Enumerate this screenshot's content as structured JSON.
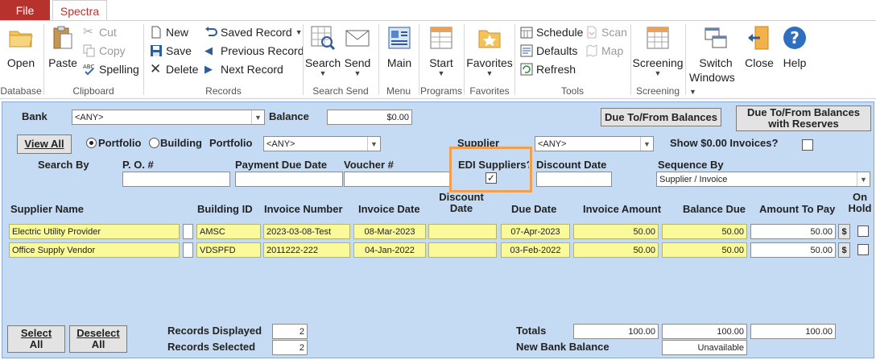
{
  "tabs": {
    "file": "File",
    "spectra": "Spectra"
  },
  "ribbon": {
    "database": {
      "label": "Database",
      "open": "Open"
    },
    "clipboard": {
      "label": "Clipboard",
      "paste": "Paste",
      "cut": "Cut",
      "copy": "Copy",
      "spelling": "Spelling"
    },
    "records": {
      "label": "Records",
      "new": "New",
      "save": "Save",
      "delete": "Delete",
      "saved_record": "Saved Record",
      "previous_record": "Previous Record",
      "next_record": "Next Record"
    },
    "search_send": {
      "label": "Search Send",
      "search": "Search",
      "send": "Send"
    },
    "menu": {
      "label": "Menu",
      "main": "Main"
    },
    "programs": {
      "label": "Programs",
      "start": "Start"
    },
    "favorites": {
      "label": "Favorites",
      "favorites": "Favorites"
    },
    "tools": {
      "label": "Tools",
      "schedule": "Schedule",
      "defaults": "Defaults",
      "refresh": "Refresh",
      "scan": "Scan",
      "map": "Map"
    },
    "screening": {
      "label": "Screening",
      "screening": "Screening"
    },
    "window": {
      "switch_windows_line1": "Switch",
      "switch_windows_line2": "Windows",
      "close": "Close",
      "help": "Help"
    }
  },
  "form": {
    "bank_label": "Bank",
    "bank_value": "<ANY>",
    "balance_label": "Balance",
    "balance_value": "$0.00",
    "due_to_from_btn": "Due To/From Balances",
    "due_to_from_reserves_btn_line1": "Due To/From Balances",
    "due_to_from_reserves_btn_line2": "with Reserves",
    "view_all_btn": "View All",
    "portfolio_radio": "Portfolio",
    "building_radio": "Building",
    "portfolio_label": "Portfolio",
    "portfolio_value": "<ANY>",
    "supplier_label": "Supplier",
    "supplier_value": "<ANY>",
    "show_zero_label": "Show $0.00 Invoices?",
    "search_by_label": "Search By",
    "po_label": "P. O. #",
    "payment_due_label": "Payment Due Date",
    "voucher_label": "Voucher #",
    "edi_label": "EDI Suppliers?",
    "discount_date_label": "Discount Date",
    "sequence_label": "Sequence By",
    "sequence_value": "Supplier / Invoice"
  },
  "table": {
    "headers": {
      "supplier_name": "Supplier Name",
      "building_id": "Building ID",
      "invoice_number": "Invoice Number",
      "invoice_date": "Invoice Date",
      "discount_date_1": "Discount",
      "discount_date_2": "Date",
      "due_date": "Due Date",
      "invoice_amount": "Invoice Amount",
      "balance_due": "Balance Due",
      "amount_to_pay": "Amount To Pay",
      "on_hold_1": "On",
      "on_hold_2": "Hold"
    },
    "rows": [
      {
        "supplier": "Electric Utility Provider",
        "building": "AMSC",
        "invoice_number": "2023-03-08-Test",
        "invoice_date": "08-Mar-2023",
        "discount_date": "",
        "due_date": "07-Apr-2023",
        "invoice_amount": "50.00",
        "balance_due": "50.00",
        "amount_to_pay": "50.00",
        "dollar": "$"
      },
      {
        "supplier": "Office Supply Vendor",
        "building": "VDSPFD",
        "invoice_number": "2011222-222",
        "invoice_date": "04-Jan-2022",
        "discount_date": "",
        "due_date": "03-Feb-2022",
        "invoice_amount": "50.00",
        "balance_due": "50.00",
        "amount_to_pay": "50.00",
        "dollar": "$"
      }
    ]
  },
  "footer": {
    "select_all_1": "Select",
    "select_all_2": "All",
    "deselect_all_1": "Deselect",
    "deselect_all_2": "All",
    "records_displayed_label": "Records Displayed",
    "records_displayed_value": "2",
    "records_selected_label": "Records Selected",
    "records_selected_value": "2",
    "totals_label": "Totals",
    "total_invoice_amount": "100.00",
    "total_balance_due": "100.00",
    "total_amount_to_pay": "100.00",
    "new_bank_balance_label": "New Bank Balance",
    "new_bank_balance_value": "Unavailable"
  },
  "colors": {
    "file_tab": "#b7322c",
    "form_bg": "#c5dbf4",
    "yellow_field": "#fafa9a",
    "highlight_box": "#f0a050"
  }
}
